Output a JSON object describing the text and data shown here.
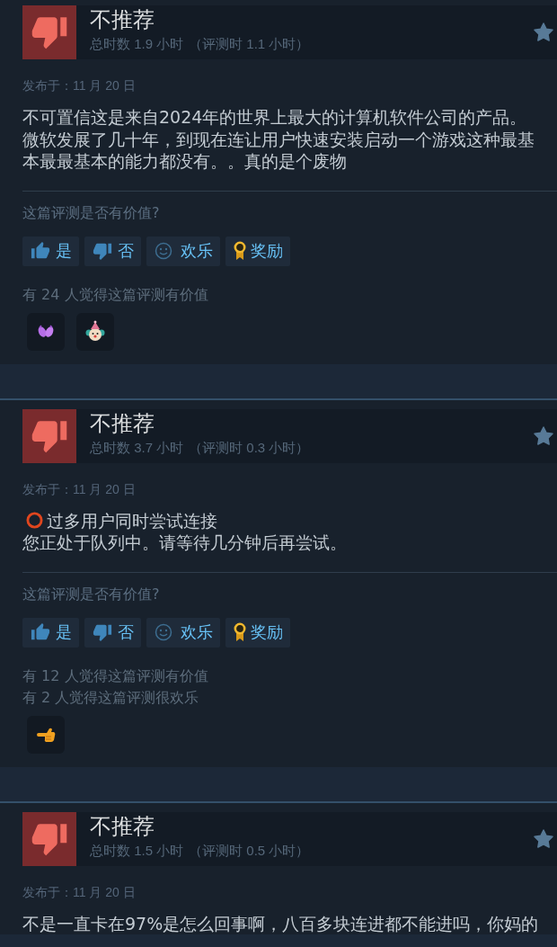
{
  "reviews": [
    {
      "recommended": false,
      "verdict": "不推荐",
      "hours": "总时数 1.9 小时",
      "review_hours": "（评测时 1.1 小时）",
      "posted": "发布于：11 月 20 日",
      "body": [
        {
          "kind": "plain",
          "text": "不可置信这是来自2024年的世界上最大的计算机软件公司的产品。微软发展了几十年，到现在连让用户快速安装启动一个游戏这种最基本最最基本的能力都没有。。真的是个废物"
        }
      ],
      "helpful_question": "这篇评测是否有价值?",
      "buttons": [
        {
          "kind": "yes",
          "label": "是"
        },
        {
          "kind": "no",
          "label": "否"
        },
        {
          "kind": "funny",
          "label": "欢乐"
        },
        {
          "kind": "award",
          "label": "奖励"
        }
      ],
      "votes": [
        "有 24 人觉得这篇评测有价值"
      ],
      "reactions": [
        {
          "kind": "hands"
        },
        {
          "kind": "clown"
        }
      ]
    },
    {
      "recommended": false,
      "verdict": "不推荐",
      "hours": "总时数 3.7 小时",
      "review_hours": "（评测时 0.3 小时）",
      "posted": "发布于：11 月 20 日",
      "body": [
        {
          "kind": "alert",
          "text": "过多用户同时尝试连接"
        },
        {
          "kind": "plain",
          "text": "您正处于队列中。请等待几分钟后再尝试。"
        }
      ],
      "helpful_question": "这篇评测是否有价值?",
      "buttons": [
        {
          "kind": "yes",
          "label": "是"
        },
        {
          "kind": "no",
          "label": "否"
        },
        {
          "kind": "funny",
          "label": "欢乐"
        },
        {
          "kind": "award",
          "label": "奖励"
        }
      ],
      "votes": [
        "有 12 人觉得这篇评测有价值",
        "有 2 人觉得这篇评测很欢乐"
      ],
      "reactions": [
        {
          "kind": "pointing_hand"
        }
      ]
    },
    {
      "recommended": false,
      "verdict": "不推荐",
      "hours": "总时数 1.5 小时",
      "review_hours": "（评测时 0.5 小时）",
      "posted": "发布于：11 月 20 日",
      "body": [
        {
          "kind": "plain",
          "text": "不是一直卡在97%是怎么回事啊，八百多块连进都不能进吗，你妈的"
        }
      ]
    }
  ]
}
